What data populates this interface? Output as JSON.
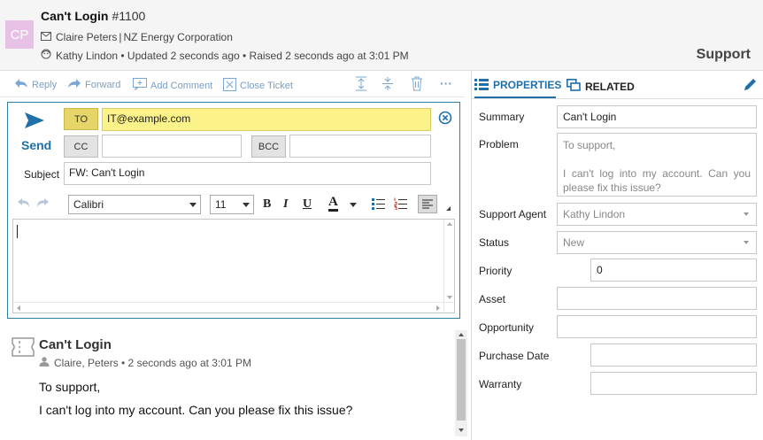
{
  "header": {
    "avatar_initials": "CP",
    "title": "Can't Login",
    "ticket_number": "#1100",
    "contact_name": "Claire Peters",
    "separator": "|",
    "company": "NZ Energy Corporation",
    "status_line": "Kathy Lindon • Updated 2 seconds ago • Raised 2 seconds ago at 3:01 PM",
    "section": "Support"
  },
  "toolbar": {
    "reply": "Reply",
    "forward": "Forward",
    "add_comment": "Add Comment",
    "close_ticket": "Close Ticket",
    "more": "···"
  },
  "compose": {
    "send_label": "Send",
    "to_label": "TO",
    "to_value": "IT@example.com",
    "cc_label": "CC",
    "cc_value": "",
    "bcc_label": "BCC",
    "bcc_value": "",
    "subject_label": "Subject",
    "subject_value": "FW: Can't Login",
    "font_name": "Calibri",
    "font_size": "11",
    "bold": "B",
    "italic": "I",
    "underline": "U",
    "font_color_letter": "A",
    "body": ""
  },
  "message": {
    "title": "Can't Login",
    "meta": "Claire, Peters • 2 seconds ago at 3:01 PM",
    "line1": "To support,",
    "line2": "I can't log into my account. Can you please fix this issue?"
  },
  "panel": {
    "tab_properties": "PROPERTIES",
    "tab_related": "RELATED",
    "summary_label": "Summary",
    "summary_value": "Can't Login",
    "problem_label": "Problem",
    "problem_line1": "To support,",
    "problem_line2": "I  can't log  into my  account.  Can  you please fix this issue?",
    "agent_label": "Support Agent",
    "agent_value": "Kathy Lindon",
    "status_label": "Status",
    "status_value": "New",
    "priority_label": "Priority",
    "priority_value": "0",
    "asset_label": "Asset",
    "asset_value": "",
    "opportunity_label": "Opportunity",
    "opportunity_value": "",
    "purchase_date_label": "Purchase Date",
    "purchase_date_value": "",
    "warranty_label": "Warranty",
    "warranty_value": ""
  },
  "colors": {
    "accent": "#1f6fa8",
    "avatar_bg": "#e8c2e6",
    "to_highlight": "#fbf28a",
    "to_label_bg": "#e6d66a"
  }
}
